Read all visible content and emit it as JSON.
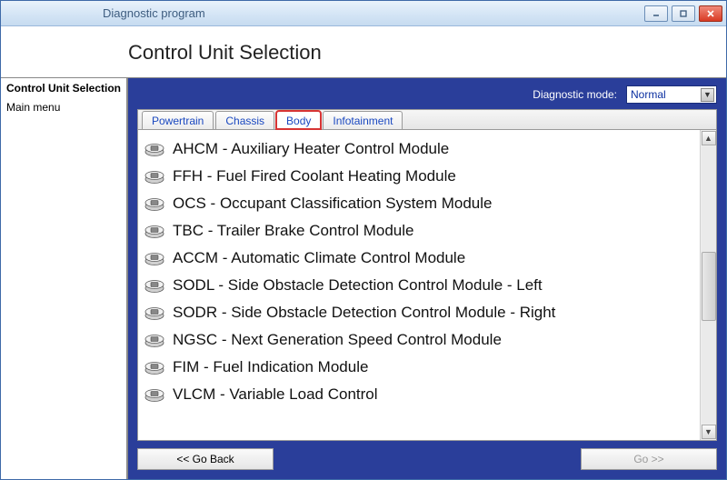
{
  "window": {
    "title": "Diagnostic program"
  },
  "header": {
    "heading": "Control Unit Selection"
  },
  "sidebar": {
    "current": "Control Unit Selection",
    "items": [
      {
        "label": "Main menu"
      }
    ]
  },
  "mode": {
    "label": "Diagnostic mode:",
    "selected": "Normal"
  },
  "tabs": [
    {
      "id": "powertrain",
      "label": "Powertrain",
      "active": false
    },
    {
      "id": "chassis",
      "label": "Chassis",
      "active": false
    },
    {
      "id": "body",
      "label": "Body",
      "active": true
    },
    {
      "id": "infotainment",
      "label": "Infotainment",
      "active": false
    }
  ],
  "modules": [
    {
      "label": "AHCM - Auxiliary Heater Control Module"
    },
    {
      "label": "FFH - Fuel Fired Coolant Heating Module"
    },
    {
      "label": "OCS - Occupant Classification System Module"
    },
    {
      "label": "TBC - Trailer Brake Control Module"
    },
    {
      "label": "ACCM - Automatic Climate Control Module"
    },
    {
      "label": "SODL - Side Obstacle Detection Control Module - Left"
    },
    {
      "label": "SODR - Side Obstacle Detection Control Module - Right"
    },
    {
      "label": "NGSC - Next Generation Speed Control Module"
    },
    {
      "label": "FIM - Fuel Indication Module"
    },
    {
      "label": "VLCM - Variable Load Control"
    }
  ],
  "scrollbar": {
    "thumb_top_pct": 38,
    "thumb_height_pct": 25
  },
  "footer": {
    "back_label": "<< Go Back",
    "go_label": "Go >>",
    "go_enabled": false
  }
}
